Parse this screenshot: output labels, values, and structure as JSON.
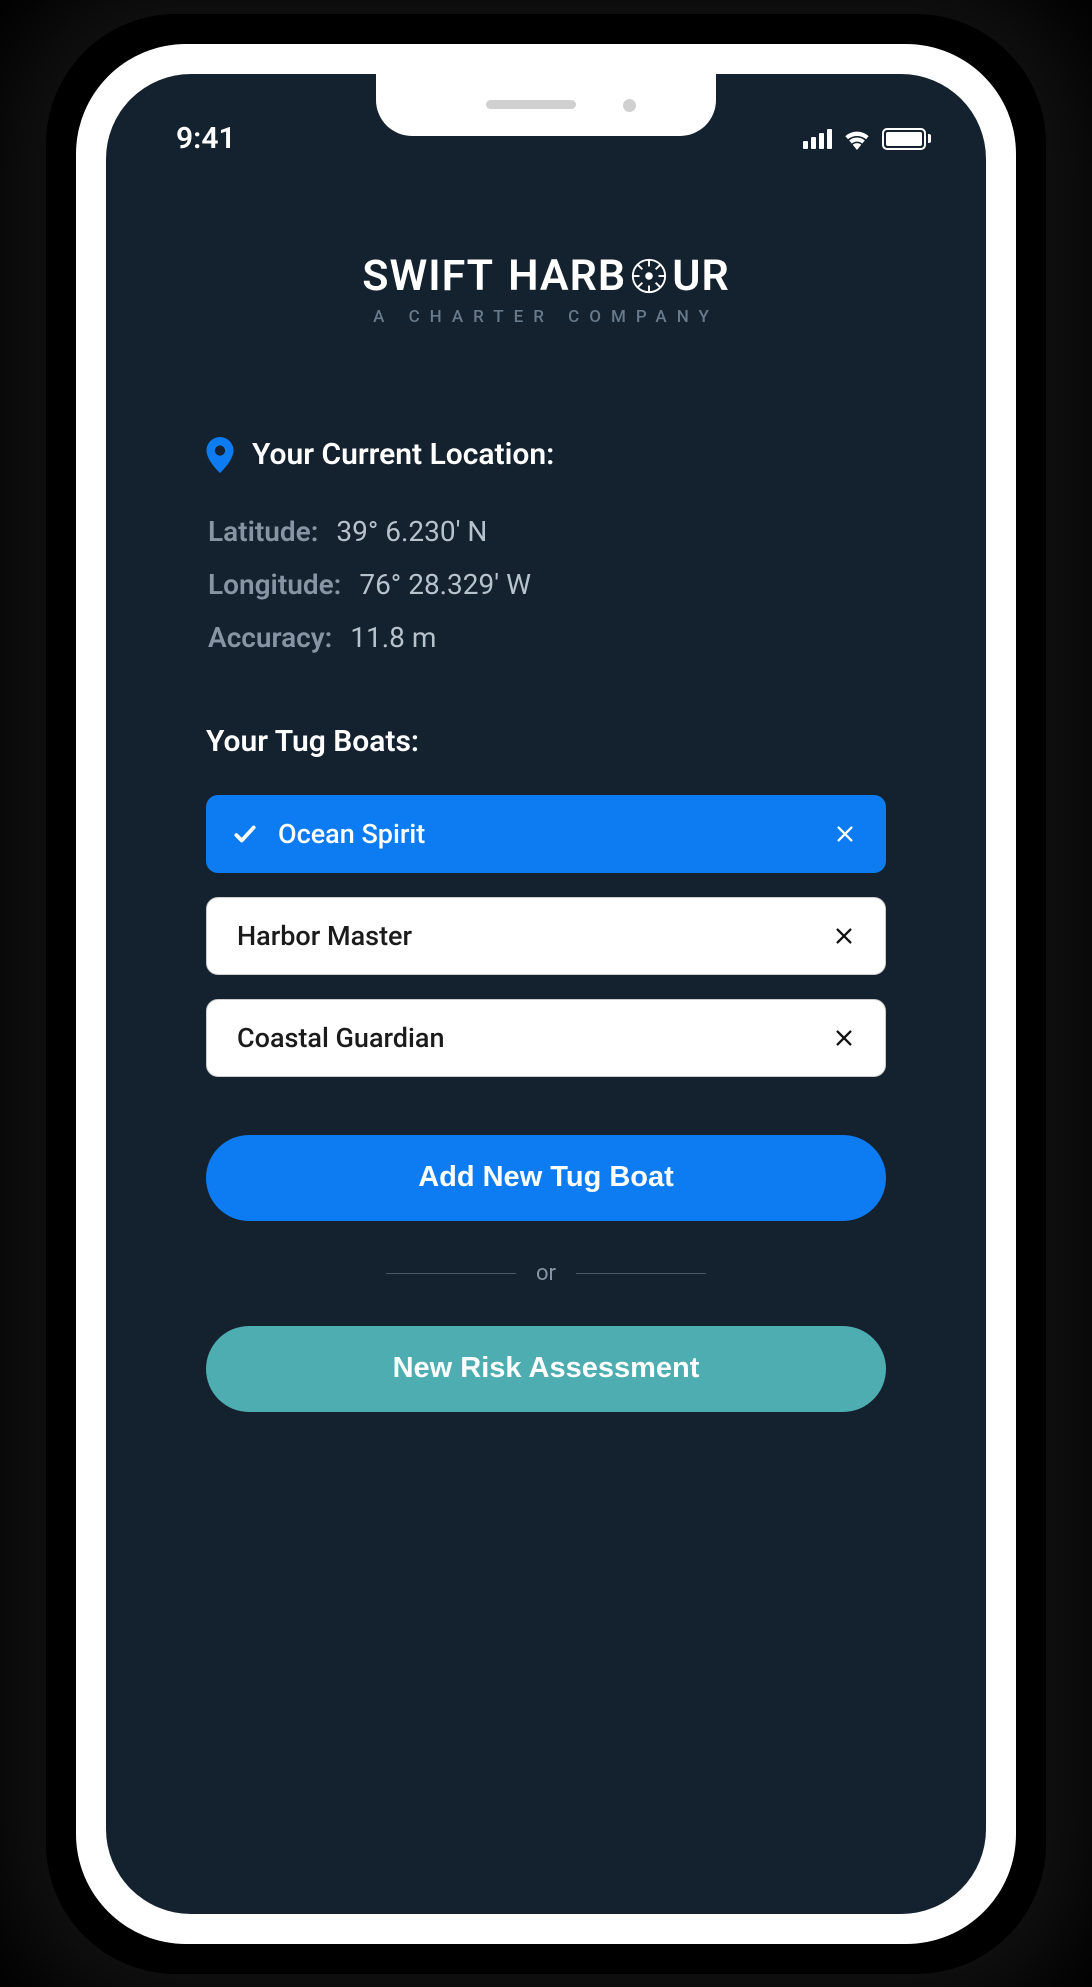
{
  "status": {
    "time": "9:41"
  },
  "logo": {
    "main_part1": "SWIFT",
    "main_part2": "HARB",
    "main_part3": "UR",
    "subtitle": "A CHARTER COMPANY"
  },
  "location": {
    "header": "Your Current Location:",
    "latitude_label": "Latitude:",
    "latitude_value": "39° 6.230' N",
    "longitude_label": "Longitude:",
    "longitude_value": "76° 28.329' W",
    "accuracy_label": "Accuracy:",
    "accuracy_value": "11.8 m"
  },
  "boats": {
    "header": "Your Tug Boats:",
    "items": [
      {
        "name": "Ocean Spirit",
        "selected": true
      },
      {
        "name": "Harbor Master",
        "selected": false
      },
      {
        "name": "Coastal Guardian",
        "selected": false
      }
    ]
  },
  "actions": {
    "add_button": "Add New Tug Boat",
    "divider_text": "or",
    "assessment_button": "New Risk Assessment"
  },
  "colors": {
    "primary_blue": "#0D7CF2",
    "teal": "#4DADB0",
    "background": "#14212E"
  }
}
